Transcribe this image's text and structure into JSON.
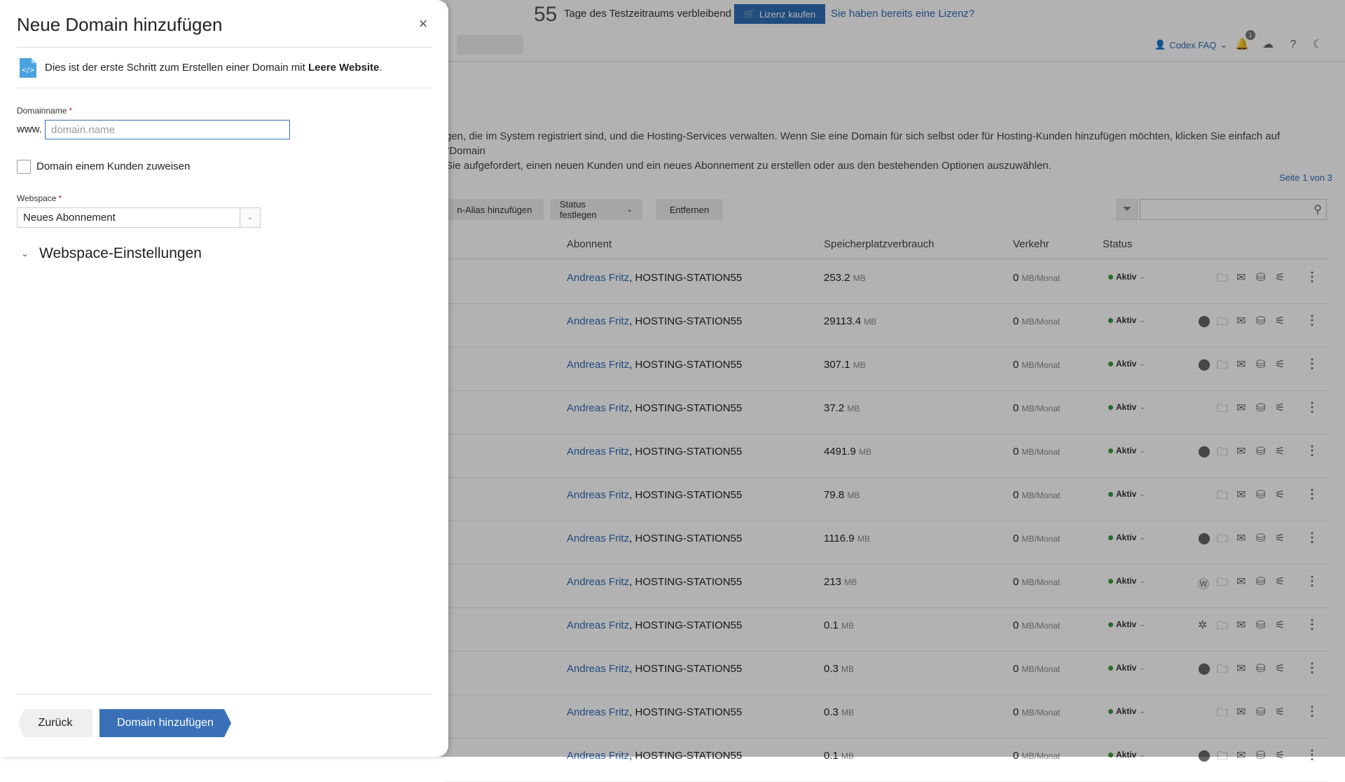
{
  "trial": {
    "days": "55",
    "text": "Tage des Testzeitraums verbleibend",
    "buy_label": "Lizenz kaufen",
    "license_link": "Sie haben bereits eine Lizenz?"
  },
  "header": {
    "user_name": "Codex FAQ",
    "notification_count": "1"
  },
  "intro": {
    "line1": "gen, die im System registriert sind, und die Hosting-Services verwalten. Wenn Sie eine Domain für sich selbst oder für Hosting-Kunden hinzufügen möchten, klicken Sie einfach auf \"Domain",
    "line2": "Sie aufgefordert, einen neuen Kunden und ein neues Abonnement zu erstellen oder aus den bestehenden Optionen auszuwählen."
  },
  "pagination": {
    "text": "Seite 1 von 3"
  },
  "toolbar": {
    "alias_label": "n-Alias hinzufügen",
    "status_label": "Status festlegen",
    "remove_label": "Entfernen"
  },
  "table": {
    "columns": [
      "Abonnent",
      "Speicherplatzverbrauch",
      "Verkehr",
      "Status"
    ],
    "rows": [
      {
        "owner": "Andreas Fritz",
        "suffix": ", HOSTING-STATION55",
        "disk": "253.2",
        "disk_unit": "MB",
        "traffic": "0",
        "traffic_unit": "MB/Monat",
        "status": "Aktiv",
        "extra_icon": ""
      },
      {
        "owner": "Andreas Fritz",
        "suffix": ", HOSTING-STATION55",
        "disk": "29113.4",
        "disk_unit": "MB",
        "traffic": "0",
        "traffic_unit": "MB/Monat",
        "status": "Aktiv",
        "extra_icon": "php"
      },
      {
        "owner": "Andreas Fritz",
        "suffix": ", HOSTING-STATION55",
        "disk": "307.1",
        "disk_unit": "MB",
        "traffic": "0",
        "traffic_unit": "MB/Monat",
        "status": "Aktiv",
        "extra_icon": "php"
      },
      {
        "owner": "Andreas Fritz",
        "suffix": ", HOSTING-STATION55",
        "disk": "37.2",
        "disk_unit": "MB",
        "traffic": "0",
        "traffic_unit": "MB/Monat",
        "status": "Aktiv",
        "extra_icon": ""
      },
      {
        "owner": "Andreas Fritz",
        "suffix": ", HOSTING-STATION55",
        "disk": "4491.9",
        "disk_unit": "MB",
        "traffic": "0",
        "traffic_unit": "MB/Monat",
        "status": "Aktiv",
        "extra_icon": "php"
      },
      {
        "owner": "Andreas Fritz",
        "suffix": ", HOSTING-STATION55",
        "disk": "79.8",
        "disk_unit": "MB",
        "traffic": "0",
        "traffic_unit": "MB/Monat",
        "status": "Aktiv",
        "extra_icon": ""
      },
      {
        "owner": "Andreas Fritz",
        "suffix": ", HOSTING-STATION55",
        "disk": "1116.9",
        "disk_unit": "MB",
        "traffic": "0",
        "traffic_unit": "MB/Monat",
        "status": "Aktiv",
        "extra_icon": "php"
      },
      {
        "owner": "Andreas Fritz",
        "suffix": ", HOSTING-STATION55",
        "disk": "213",
        "disk_unit": "MB",
        "traffic": "0",
        "traffic_unit": "MB/Monat",
        "status": "Aktiv",
        "extra_icon": "wordpress"
      },
      {
        "owner": "Andreas Fritz",
        "suffix": ", HOSTING-STATION55",
        "disk": "0.1",
        "disk_unit": "MB",
        "traffic": "0",
        "traffic_unit": "MB/Monat",
        "status": "Aktiv",
        "extra_icon": "joomla"
      },
      {
        "owner": "Andreas Fritz",
        "suffix": ", HOSTING-STATION55",
        "disk": "0.3",
        "disk_unit": "MB",
        "traffic": "0",
        "traffic_unit": "MB/Monat",
        "status": "Aktiv",
        "extra_icon": "php"
      },
      {
        "owner": "Andreas Fritz",
        "suffix": ", HOSTING-STATION55",
        "disk": "0.3",
        "disk_unit": "MB",
        "traffic": "0",
        "traffic_unit": "MB/Monat",
        "status": "Aktiv",
        "extra_icon": ""
      },
      {
        "owner": "Andreas Fritz",
        "suffix": ", HOSTING-STATION55",
        "disk": "0.1",
        "disk_unit": "MB",
        "traffic": "0",
        "traffic_unit": "MB/Monat",
        "status": "Aktiv",
        "extra_icon": "php"
      }
    ]
  },
  "drawer": {
    "title": "Neue Domain hinzufügen",
    "info_prefix": "Dies ist der erste Schritt zum Erstellen einer Domain mit ",
    "info_bold": "Leere Website",
    "info_suffix": ".",
    "domain_label": "Domainname",
    "required_mark": "*",
    "www_prefix": "www.",
    "domain_placeholder": "domain.name",
    "domain_value": "",
    "assign_customer_label": "Domain einem Kunden zuweisen",
    "webspace_label": "Webspace",
    "webspace_value": "Neues Abonnement",
    "webspace_section_title": "Webspace-Einstellungen",
    "back_label": "Zurück",
    "submit_label": "Domain hinzufügen"
  },
  "colors": {
    "accent": "#3970b8",
    "link": "#2f6db5",
    "status_active": "#3c9a3c",
    "required": "#d02020"
  }
}
